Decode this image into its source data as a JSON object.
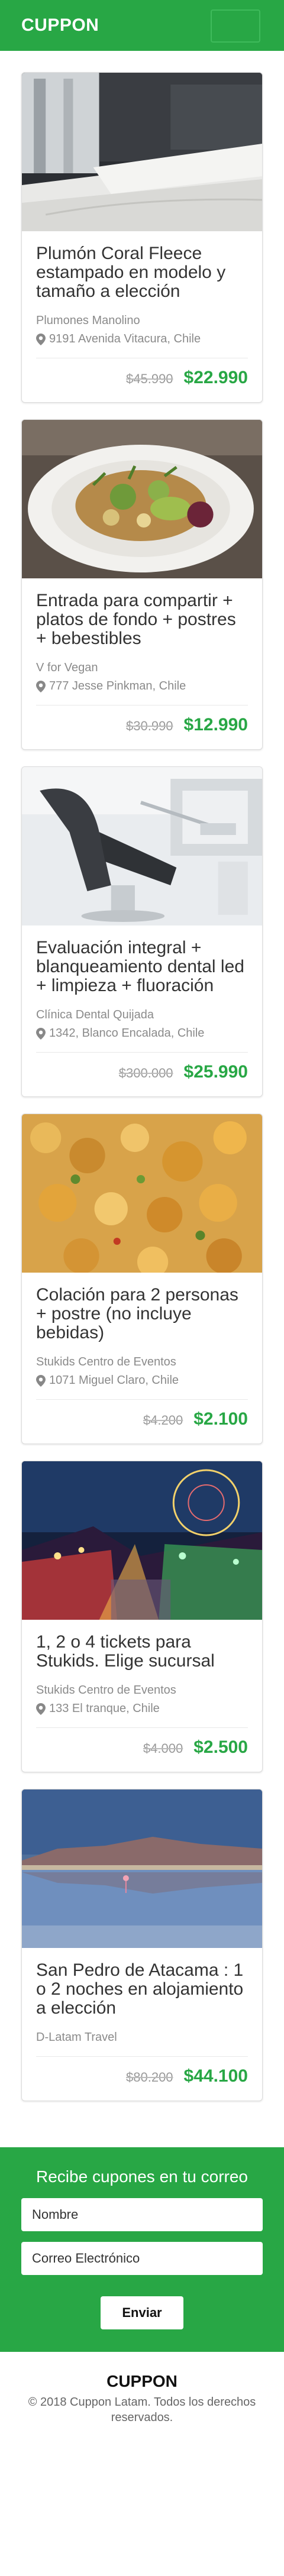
{
  "header": {
    "brand": "CUPPON"
  },
  "deals": [
    {
      "title": "Plumón Coral Fleece estampado en modelo y tamaño a elección",
      "vendor": "Plumones Manolino",
      "address": "9191 Avenida Vitacura, Chile",
      "old_price": "$45.990",
      "price": "$22.990"
    },
    {
      "title": "Entrada para compartir + platos de fondo + postres + bebestibles",
      "vendor": "V for Vegan",
      "address": "777 Jesse Pinkman, Chile",
      "old_price": "$30.990",
      "price": "$12.990"
    },
    {
      "title": "Evaluación integral + blanqueamiento dental led + limpieza + fluoración",
      "vendor": "Clínica Dental Quijada",
      "address": "1342, Blanco Encalada, Chile",
      "old_price": "$300.000",
      "price": "$25.990"
    },
    {
      "title": "Colación para 2 personas + postre (no incluye bebidas)",
      "vendor": "Stukids Centro de Eventos",
      "address": "1071 Miguel Claro, Chile",
      "old_price": "$4.200",
      "price": "$2.100"
    },
    {
      "title": "1, 2 o 4 tickets para Stukids. Elige sucursal",
      "vendor": "Stukids Centro de Eventos",
      "address": "133 El tranque, Chile",
      "old_price": "$4.000",
      "price": "$2.500"
    },
    {
      "title": "San Pedro de Atacama : 1 o 2 noches en alojamiento a elección",
      "vendor": "D-Latam Travel",
      "address": "",
      "old_price": "$80.200",
      "price": "$44.100"
    }
  ],
  "newsletter": {
    "heading": "Recibe cupones en tu correo",
    "name_placeholder": "Nombre",
    "email_placeholder": "Correo Electrónico",
    "submit_label": "Enviar"
  },
  "footer": {
    "brand": "CUPPON",
    "copyright": "© 2018 Cuppon Latam. Todos los derechos reservados."
  },
  "colors": {
    "primary": "#28a745",
    "text": "#333333",
    "muted": "#8a8a8a"
  }
}
